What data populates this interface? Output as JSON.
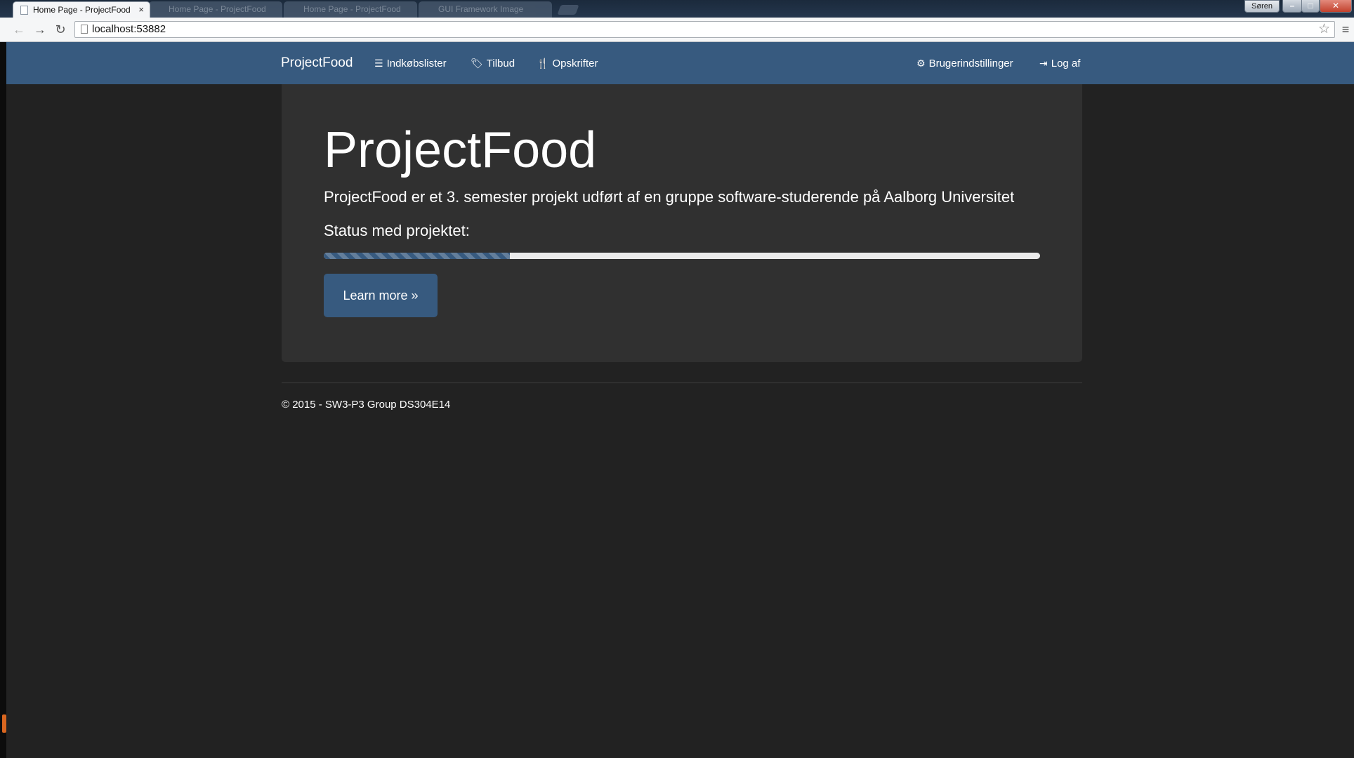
{
  "browser": {
    "active_tab": {
      "title": "Home Page - ProjectFood",
      "close": "×"
    },
    "inactive_tabs": [
      {
        "title": "Home Page - ProjectFood",
        "close": "×"
      },
      {
        "title": "Home Page - ProjectFood",
        "close": "×"
      },
      {
        "title": "GUI Framework Image",
        "close": "×"
      }
    ],
    "user_button": "Søren",
    "window_controls": {
      "minimize": "–",
      "maximize": "□",
      "close": "✕"
    },
    "back_icon": "←",
    "forward_icon": "→",
    "reload_icon": "↻",
    "address": "localhost:53882",
    "star_icon": "☆",
    "menu_icon": "≡"
  },
  "navbar": {
    "brand": "ProjectFood",
    "left_links": [
      {
        "icon": "list-icon",
        "glyph": "☰",
        "label": "Indkøbslister"
      },
      {
        "icon": "tag-icon",
        "glyph": "🏷",
        "label": "Tilbud"
      },
      {
        "icon": "cutlery-icon",
        "glyph": "🍴",
        "label": "Opskrifter"
      }
    ],
    "right_links": [
      {
        "icon": "gear-icon",
        "glyph": "⚙",
        "label": "Brugerindstillinger"
      },
      {
        "icon": "logout-icon",
        "glyph": "⇥",
        "label": "Log af"
      }
    ]
  },
  "jumbotron": {
    "title": "ProjectFood",
    "lead": "ProjectFood er et 3. semester projekt udført af en gruppe software-studerende på Aalborg Universitet",
    "status_label": "Status med projektet:",
    "progress_percent": 26,
    "button": "Learn more »"
  },
  "footer": {
    "text": "© 2015 - SW3-P3 Group DS304E14"
  },
  "colors": {
    "navbar": "#375a7f",
    "background": "#222222",
    "jumbotron": "#303030",
    "progress_track": "#ebebeb"
  }
}
